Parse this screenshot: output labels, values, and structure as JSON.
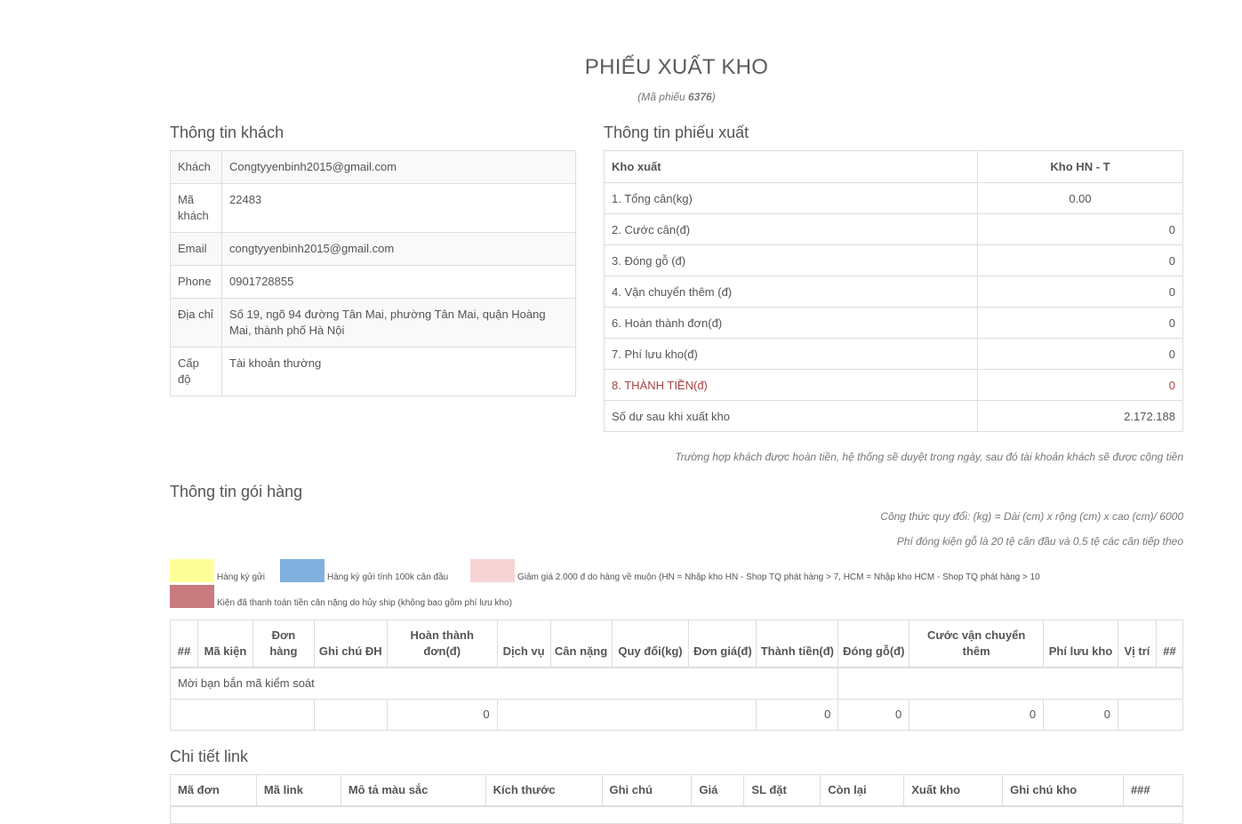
{
  "header": {
    "title": "PHIẾU XUẤT KHO",
    "code_prefix": "(Mã phiếu ",
    "code_value": "6376",
    "code_suffix": ")"
  },
  "customer": {
    "section_title": "Thông tin khách",
    "rows": [
      {
        "label": "Khách",
        "value": "Congtyyenbinh2015@gmail.com"
      },
      {
        "label": "Mã khách",
        "value": "22483"
      },
      {
        "label": "Email",
        "value": "congtyyenbinh2015@gmail.com"
      },
      {
        "label": "Phone",
        "value": "0901728855"
      },
      {
        "label": "Địa chỉ",
        "value": "Số 19, ngõ 94 đường Tân Mai, phường Tân Mai, quận Hoàng Mai, thành phố Hà Nội"
      },
      {
        "label": "Cấp độ",
        "value": "Tài khoản thường"
      }
    ]
  },
  "voucher": {
    "section_title": "Thông tin phiếu xuất",
    "warehouse_label": "Kho xuất",
    "warehouse_value": "Kho HN - T",
    "rows": [
      {
        "label": "1. Tổng cân(kg)",
        "value": "0.00"
      },
      {
        "label": "2. Cước cân(đ)",
        "value": "0"
      },
      {
        "label": "3. Đóng gỗ (đ)",
        "value": "0"
      },
      {
        "label": "4. Vận chuyển thêm (đ)",
        "value": "0"
      },
      {
        "label": "6. Hoàn thành đơn(đ)",
        "value": "0"
      },
      {
        "label": "7. Phí lưu kho(đ)",
        "value": "0"
      }
    ],
    "total_label": "8. THÀNH TIỀN(đ)",
    "total_value": "0",
    "balance_label": "Số dư sau khi xuất kho",
    "balance_value": "2.172.188",
    "refund_note": "Trường hợp khách được hoàn tiền, hệ thống sẽ duyệt trong ngày, sau đó tài khoản khách sẽ được cộng tiền"
  },
  "packages": {
    "section_title": "Thông tin gói hàng",
    "formula_note": "Công thức quy đổi: (kg) = Dài (cm) x rộng (cm) x cao (cm)/ 6000",
    "wood_note": "Phí đóng kiện gỗ là 20 tệ cân đầu và 0.5 tệ các cân tiếp theo",
    "legend": [
      {
        "color": "#ffff99",
        "text": "Hàng ký gửi"
      },
      {
        "color": "#7fb0de",
        "text": "Hàng ký gửi tính 100k cân đầu"
      },
      {
        "color": "#f8d3d5",
        "text": "Giảm giá 2.000 đ do hàng về muộn (HN = Nhập kho HN - Shop TQ phát hàng > 7, HCM = Nhập kho HCM - Shop TQ phát hàng > 10"
      },
      {
        "color": "#c87b7e",
        "text": "Kiện đã thanh toán tiền cân nặng do hủy ship (không bao gồm phí lưu kho)"
      }
    ],
    "columns": [
      "##",
      "Mã kiện",
      "Đơn hàng",
      "Ghi chú ĐH",
      "Hoàn thành đơn(đ)",
      "Dịch vụ",
      "Cân nặng",
      "Quy đổi(kg)",
      "Đơn giá(đ)",
      "Thành tiền(đ)",
      "Đóng gỗ(đ)",
      "Cước vận chuyển thêm",
      "Phí lưu kho",
      "Vị trí",
      "##"
    ],
    "scan_prompt": "Mời bạn bắn mã kiểm soát",
    "totals": {
      "completion": "0",
      "amount": "0",
      "wood": "0",
      "extra_shipping": "0",
      "storage": "0"
    }
  },
  "links": {
    "section_title": "Chi tiết link",
    "columns": [
      "Mã đơn",
      "Mã link",
      "Mô tả màu sắc",
      "Kích thước",
      "Ghi chú",
      "Giá",
      "SL đặt",
      "Còn lại",
      "Xuất kho",
      "Ghi chú kho",
      "###"
    ]
  }
}
